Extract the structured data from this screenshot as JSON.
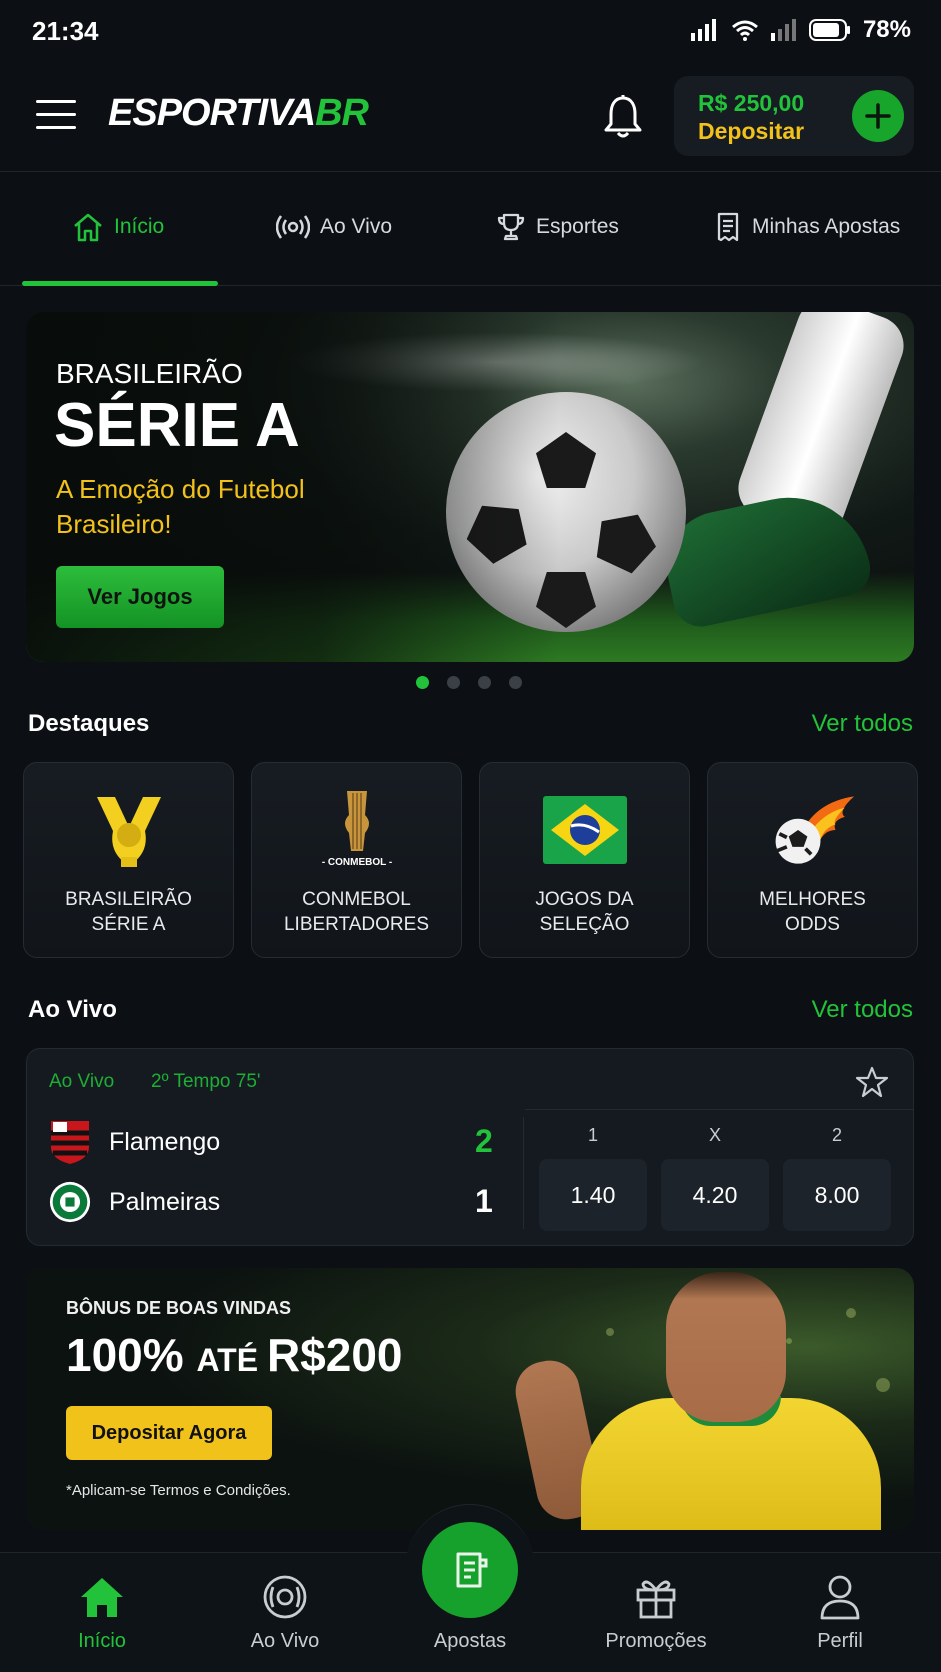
{
  "status_bar": {
    "time": "21:34",
    "battery": "78%"
  },
  "header": {
    "logo_main": "ESPORTIVA",
    "logo_accent": "BR",
    "balance": "R$ 250,00",
    "deposit_label": "Depositar"
  },
  "tabs": [
    {
      "label": "Início",
      "icon": "home-icon",
      "active": true
    },
    {
      "label": "Ao Vivo",
      "icon": "broadcast-icon",
      "active": false
    },
    {
      "label": "Esportes",
      "icon": "trophy-icon",
      "active": false
    },
    {
      "label": "Minhas Apostas",
      "icon": "receipt-icon",
      "active": false
    }
  ],
  "hero": {
    "kicker": "BRASILEIRÃO",
    "title": "SÉRIE A",
    "subtitle": "A Emoção do Futebol Brasileiro!",
    "cta": "Ver Jogos",
    "slides": 4,
    "active_slide": 1
  },
  "highlights": {
    "title": "Destaques",
    "link": "Ver todos",
    "items": [
      {
        "line1": "BRASILEIRÃO",
        "line2": "SÉRIE A",
        "icon": "brasileirao-trophy-icon"
      },
      {
        "line1": "CONMEBOL",
        "line2": "LIBERTADORES",
        "icon": "libertadores-trophy-icon",
        "icon_text": "- CONMEBOL -"
      },
      {
        "line1": "JOGOS DA",
        "line2": "SELEÇÃO",
        "icon": "brazil-flag-icon"
      },
      {
        "line1": "MELHORES",
        "line2": "ODDS",
        "icon": "flaming-ball-icon"
      }
    ]
  },
  "live": {
    "title": "Ao Vivo",
    "link": "Ver todos",
    "match": {
      "status": "Ao Vivo",
      "clock": "2º Tempo 75'",
      "home": {
        "name": "Flamengo",
        "score": "2"
      },
      "away": {
        "name": "Palmeiras",
        "score": "1"
      },
      "odds_labels": [
        "1",
        "X",
        "2"
      ],
      "odds": [
        "1.40",
        "4.20",
        "8.00"
      ]
    }
  },
  "bonus": {
    "kicker": "BÔNUS DE BOAS VINDAS",
    "headline_a": "100% ",
    "headline_b": "ATÉ ",
    "headline_c": "R$200",
    "cta": "Depositar Agora",
    "terms": "*Aplicam-se Termos e Condições."
  },
  "bottom_nav": [
    {
      "label": "Início",
      "icon": "home-icon",
      "active": true
    },
    {
      "label": "Ao Vivo",
      "icon": "live-ball-icon",
      "active": false
    },
    {
      "label": "Apostas",
      "icon": "bet-slip-icon",
      "active": false
    },
    {
      "label": "Promoções",
      "icon": "gift-icon",
      "active": false
    },
    {
      "label": "Perfil",
      "icon": "user-icon",
      "active": false
    }
  ],
  "colors": {
    "accent": "#22c33a",
    "gold": "#f2c21b",
    "background": "#0c1014"
  }
}
